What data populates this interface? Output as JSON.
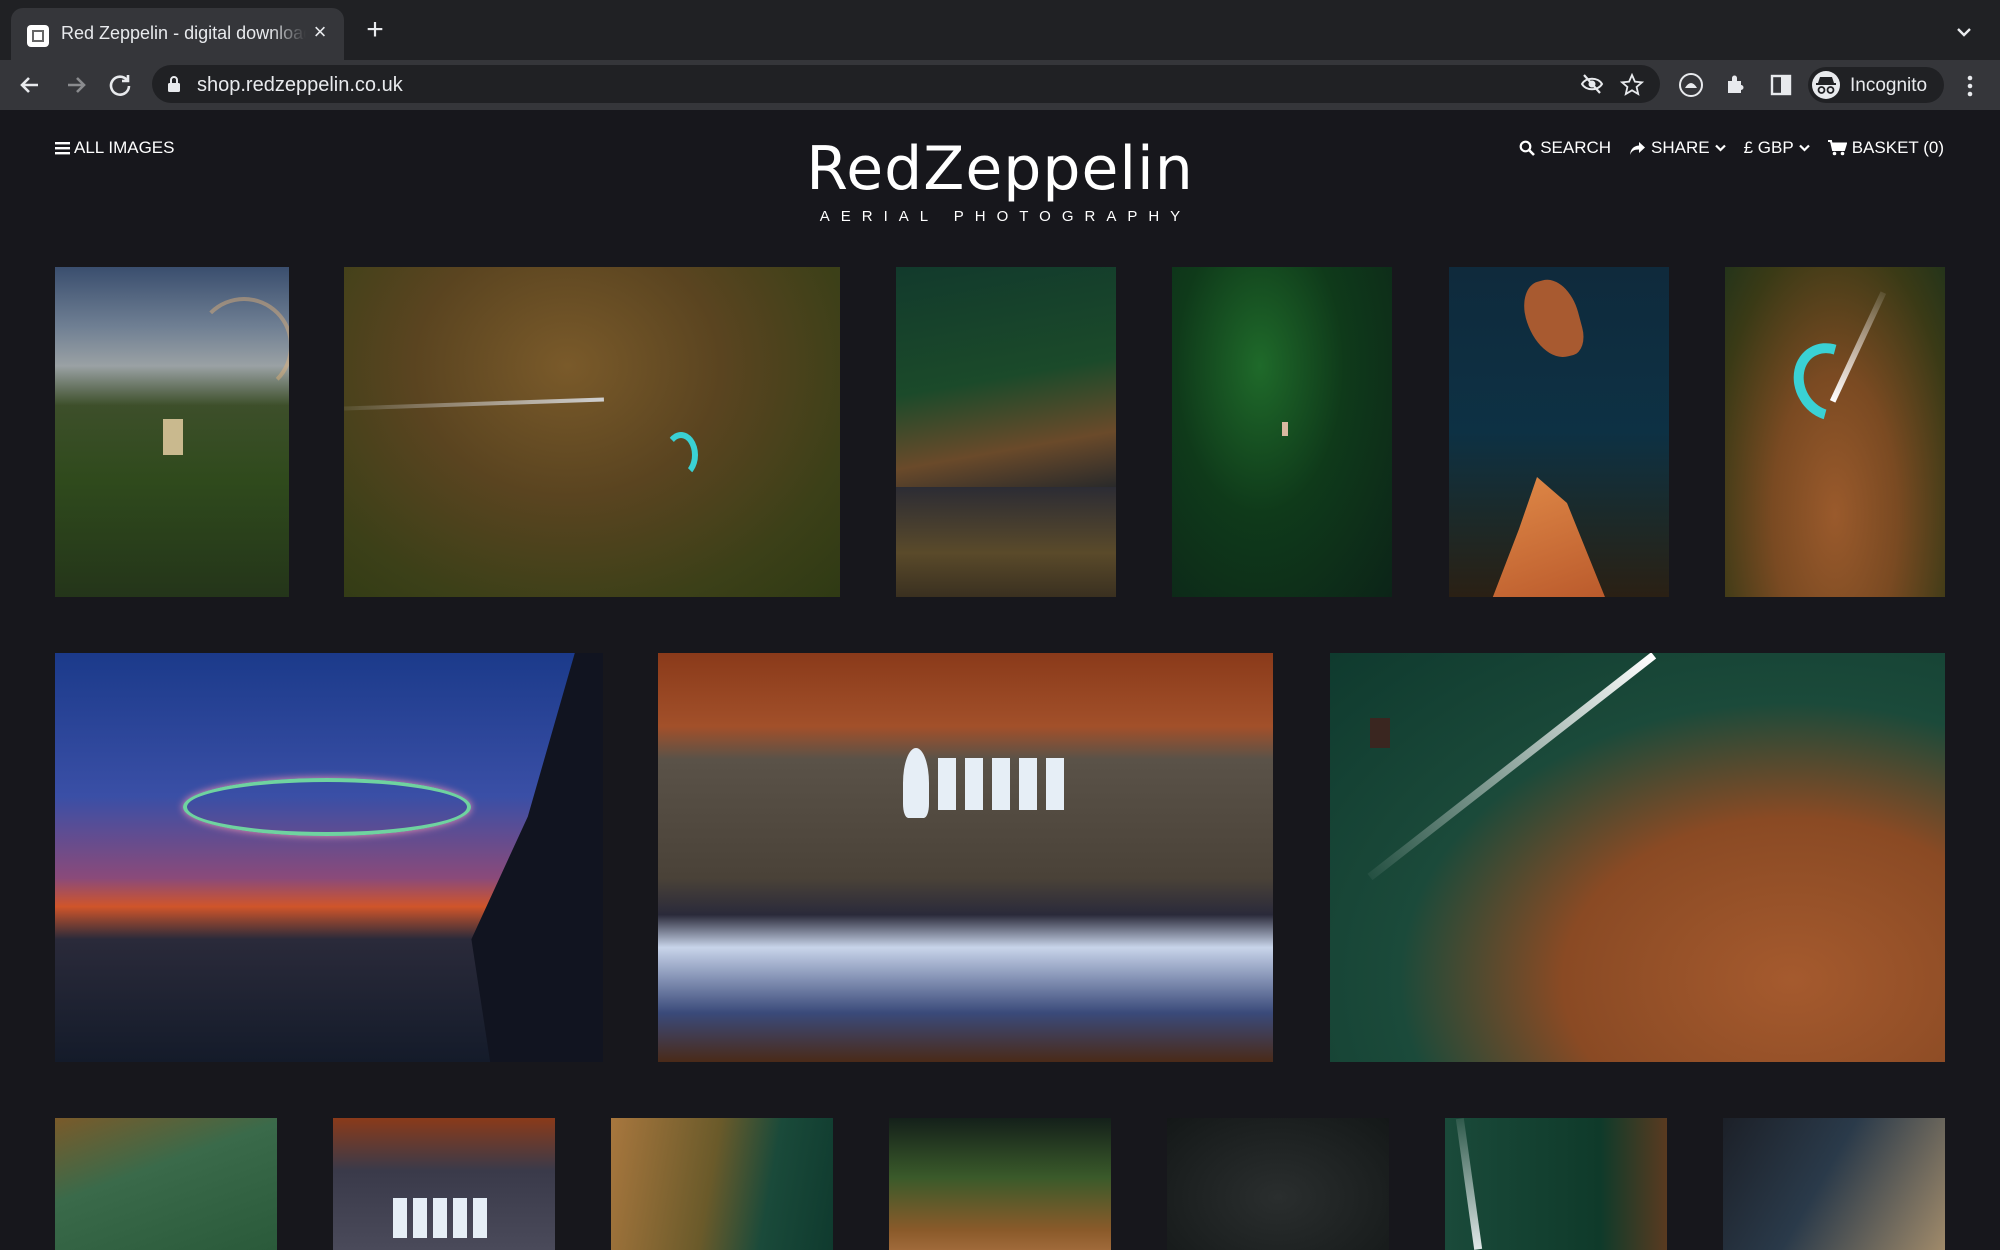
{
  "browser": {
    "tab_title": "Red Zeppelin - digital downloads",
    "url": "shop.redzeppelin.co.uk",
    "profile_label": "Incognito"
  },
  "header": {
    "menu_label": "ALL IMAGES",
    "logo_name": "RedZeppelin",
    "logo_tagline": "AERIAL PHOTOGRAPHY",
    "nav": {
      "search": "SEARCH",
      "share": "SHARE",
      "currency": "£ GBP",
      "basket": "BASKET (0)"
    }
  },
  "colors": {
    "page_bg": "#17171c",
    "chrome_dark": "#202124",
    "chrome_toolbar": "#35363a",
    "text": "#ffffff"
  },
  "gallery": {
    "rows": [
      [
        "castle-rainbow",
        "kitesurfer-wake",
        "harbour-boats",
        "green-water-boat",
        "sea-stacks",
        "kite-sandbar"
      ],
      [
        "ring-sunset",
        "beach-boats",
        "speedboat-sandbar"
      ],
      [
        "green-shallows",
        "beach-boats-small",
        "sand-ripples",
        "headland",
        "dark-water",
        "boat-wake",
        "cliff-shadow"
      ]
    ]
  }
}
